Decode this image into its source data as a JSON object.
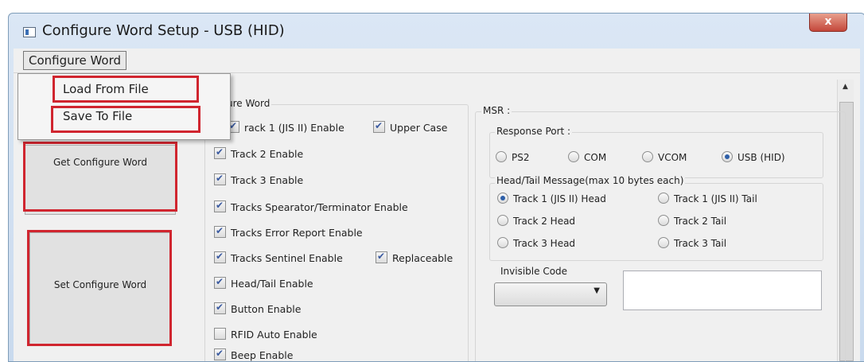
{
  "window": {
    "title": "Configure Word Setup - USB (HID)",
    "close_label": "x"
  },
  "menubar": {
    "configure_word": "Configure Word"
  },
  "dropdown": {
    "load_from_file": "Load From File",
    "save_to_file": "Save To File"
  },
  "buttons": {
    "get_configure_word": "Get Configure Word",
    "set_configure_word": "Set Configure Word"
  },
  "config_group": {
    "label": "ure Word",
    "options": [
      {
        "label": "rack 1 (JIS II) Enable",
        "checked": true
      },
      {
        "label": "Upper Case",
        "checked": true
      },
      {
        "label": "Track 2 Enable",
        "checked": true
      },
      {
        "label": "Track 3 Enable",
        "checked": true
      },
      {
        "label": "Tracks Spearator/Terminator Enable",
        "checked": true
      },
      {
        "label": "Tracks Error Report Enable",
        "checked": true
      },
      {
        "label": "Tracks Sentinel Enable",
        "checked": true
      },
      {
        "label": "Replaceable",
        "checked": true
      },
      {
        "label": "Head/Tail Enable",
        "checked": true
      },
      {
        "label": "Button Enable",
        "checked": true
      },
      {
        "label": "RFID Auto Enable",
        "checked": false
      },
      {
        "label": "Beep Enable",
        "checked": true
      }
    ]
  },
  "msr": {
    "label": "MSR :",
    "response_port": {
      "label": "Response Port :",
      "options": [
        {
          "label": "PS2",
          "selected": false
        },
        {
          "label": "COM",
          "selected": false
        },
        {
          "label": "VCOM",
          "selected": false
        },
        {
          "label": "USB (HID)",
          "selected": true
        }
      ]
    },
    "head_tail": {
      "label": "Head/Tail Message(max 10 bytes each)",
      "options": [
        {
          "label": "Track 1 (JIS II) Head",
          "selected": true
        },
        {
          "label": "Track 1 (JIS II) Tail",
          "selected": false
        },
        {
          "label": "Track 2 Head",
          "selected": false
        },
        {
          "label": "Track 2 Tail",
          "selected": false
        },
        {
          "label": "Track 3 Head",
          "selected": false
        },
        {
          "label": "Track 3 Tail",
          "selected": false
        }
      ]
    },
    "invisible_code": {
      "label": "Invisible Code",
      "value": "",
      "text_value": ""
    }
  },
  "colors": {
    "highlight": "#d0252f",
    "accent": "#2e5fa8",
    "close": "#c4473a"
  }
}
